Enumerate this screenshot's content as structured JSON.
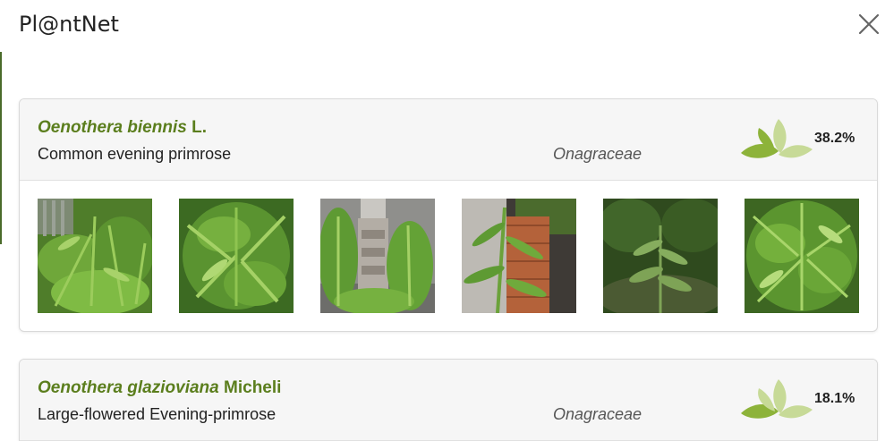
{
  "app": {
    "title": "Pl@ntNet"
  },
  "icons": {
    "close": "close-icon",
    "score": "leaf-score-icon"
  },
  "colors": {
    "accent": "#5b7e1d",
    "leaf_dark": "#8db33a",
    "leaf_light": "#c7da97"
  },
  "results": [
    {
      "genus": "Oenothera biennis",
      "author": "L.",
      "common_name": "Common evening primrose",
      "family": "Onagraceae",
      "score": "38.2%",
      "images": [
        "plant-photo-1",
        "plant-photo-2",
        "plant-photo-3",
        "plant-photo-4",
        "plant-photo-5",
        "plant-photo-6"
      ]
    },
    {
      "genus": "Oenothera glazioviana",
      "author": "Micheli",
      "common_name": "Large-flowered Evening-primrose",
      "family": "Onagraceae",
      "score": "18.1%"
    }
  ]
}
